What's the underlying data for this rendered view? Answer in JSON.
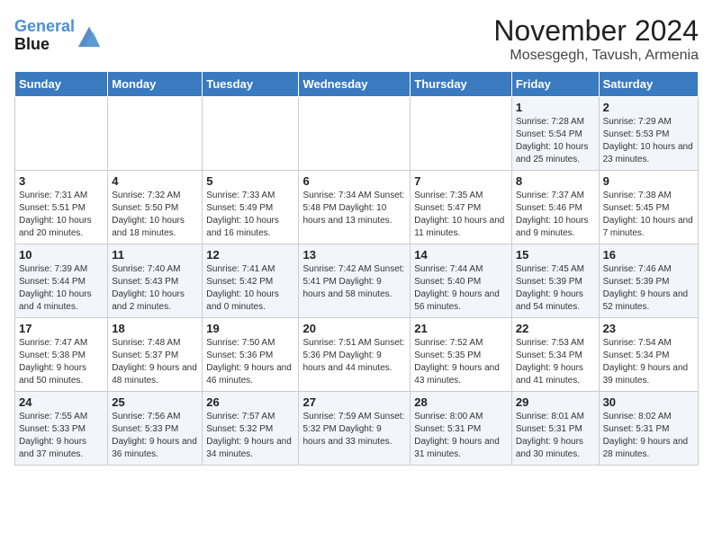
{
  "header": {
    "logo_line1": "General",
    "logo_line2": "Blue",
    "title": "November 2024",
    "subtitle": "Mosesgegh, Tavush, Armenia"
  },
  "days_of_week": [
    "Sunday",
    "Monday",
    "Tuesday",
    "Wednesday",
    "Thursday",
    "Friday",
    "Saturday"
  ],
  "weeks": [
    [
      {
        "day": "",
        "info": ""
      },
      {
        "day": "",
        "info": ""
      },
      {
        "day": "",
        "info": ""
      },
      {
        "day": "",
        "info": ""
      },
      {
        "day": "",
        "info": ""
      },
      {
        "day": "1",
        "info": "Sunrise: 7:28 AM\nSunset: 5:54 PM\nDaylight: 10 hours and 25 minutes."
      },
      {
        "day": "2",
        "info": "Sunrise: 7:29 AM\nSunset: 5:53 PM\nDaylight: 10 hours and 23 minutes."
      }
    ],
    [
      {
        "day": "3",
        "info": "Sunrise: 7:31 AM\nSunset: 5:51 PM\nDaylight: 10 hours and 20 minutes."
      },
      {
        "day": "4",
        "info": "Sunrise: 7:32 AM\nSunset: 5:50 PM\nDaylight: 10 hours and 18 minutes."
      },
      {
        "day": "5",
        "info": "Sunrise: 7:33 AM\nSunset: 5:49 PM\nDaylight: 10 hours and 16 minutes."
      },
      {
        "day": "6",
        "info": "Sunrise: 7:34 AM\nSunset: 5:48 PM\nDaylight: 10 hours and 13 minutes."
      },
      {
        "day": "7",
        "info": "Sunrise: 7:35 AM\nSunset: 5:47 PM\nDaylight: 10 hours and 11 minutes."
      },
      {
        "day": "8",
        "info": "Sunrise: 7:37 AM\nSunset: 5:46 PM\nDaylight: 10 hours and 9 minutes."
      },
      {
        "day": "9",
        "info": "Sunrise: 7:38 AM\nSunset: 5:45 PM\nDaylight: 10 hours and 7 minutes."
      }
    ],
    [
      {
        "day": "10",
        "info": "Sunrise: 7:39 AM\nSunset: 5:44 PM\nDaylight: 10 hours and 4 minutes."
      },
      {
        "day": "11",
        "info": "Sunrise: 7:40 AM\nSunset: 5:43 PM\nDaylight: 10 hours and 2 minutes."
      },
      {
        "day": "12",
        "info": "Sunrise: 7:41 AM\nSunset: 5:42 PM\nDaylight: 10 hours and 0 minutes."
      },
      {
        "day": "13",
        "info": "Sunrise: 7:42 AM\nSunset: 5:41 PM\nDaylight: 9 hours and 58 minutes."
      },
      {
        "day": "14",
        "info": "Sunrise: 7:44 AM\nSunset: 5:40 PM\nDaylight: 9 hours and 56 minutes."
      },
      {
        "day": "15",
        "info": "Sunrise: 7:45 AM\nSunset: 5:39 PM\nDaylight: 9 hours and 54 minutes."
      },
      {
        "day": "16",
        "info": "Sunrise: 7:46 AM\nSunset: 5:39 PM\nDaylight: 9 hours and 52 minutes."
      }
    ],
    [
      {
        "day": "17",
        "info": "Sunrise: 7:47 AM\nSunset: 5:38 PM\nDaylight: 9 hours and 50 minutes."
      },
      {
        "day": "18",
        "info": "Sunrise: 7:48 AM\nSunset: 5:37 PM\nDaylight: 9 hours and 48 minutes."
      },
      {
        "day": "19",
        "info": "Sunrise: 7:50 AM\nSunset: 5:36 PM\nDaylight: 9 hours and 46 minutes."
      },
      {
        "day": "20",
        "info": "Sunrise: 7:51 AM\nSunset: 5:36 PM\nDaylight: 9 hours and 44 minutes."
      },
      {
        "day": "21",
        "info": "Sunrise: 7:52 AM\nSunset: 5:35 PM\nDaylight: 9 hours and 43 minutes."
      },
      {
        "day": "22",
        "info": "Sunrise: 7:53 AM\nSunset: 5:34 PM\nDaylight: 9 hours and 41 minutes."
      },
      {
        "day": "23",
        "info": "Sunrise: 7:54 AM\nSunset: 5:34 PM\nDaylight: 9 hours and 39 minutes."
      }
    ],
    [
      {
        "day": "24",
        "info": "Sunrise: 7:55 AM\nSunset: 5:33 PM\nDaylight: 9 hours and 37 minutes."
      },
      {
        "day": "25",
        "info": "Sunrise: 7:56 AM\nSunset: 5:33 PM\nDaylight: 9 hours and 36 minutes."
      },
      {
        "day": "26",
        "info": "Sunrise: 7:57 AM\nSunset: 5:32 PM\nDaylight: 9 hours and 34 minutes."
      },
      {
        "day": "27",
        "info": "Sunrise: 7:59 AM\nSunset: 5:32 PM\nDaylight: 9 hours and 33 minutes."
      },
      {
        "day": "28",
        "info": "Sunrise: 8:00 AM\nSunset: 5:31 PM\nDaylight: 9 hours and 31 minutes."
      },
      {
        "day": "29",
        "info": "Sunrise: 8:01 AM\nSunset: 5:31 PM\nDaylight: 9 hours and 30 minutes."
      },
      {
        "day": "30",
        "info": "Sunrise: 8:02 AM\nSunset: 5:31 PM\nDaylight: 9 hours and 28 minutes."
      }
    ]
  ]
}
